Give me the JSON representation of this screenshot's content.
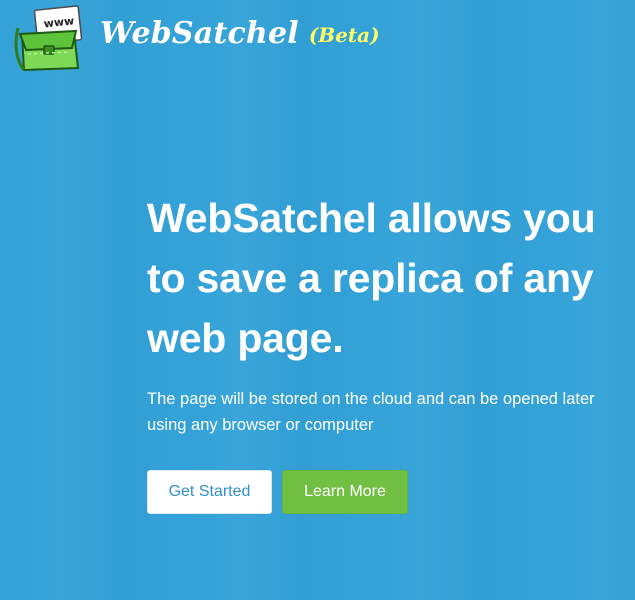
{
  "header": {
    "logo_icon": "satchel-www-icon",
    "brand_name": "WebSatchel",
    "brand_badge": "(Beta)",
    "logo_text": "www"
  },
  "hero": {
    "headline": "WebSatchel allows you to save a replica of any web page.",
    "subtext": "The page will be stored on the cloud and can be opened later using any browser or computer",
    "primary_button": "Get Started",
    "secondary_button": "Learn More"
  },
  "colors": {
    "background": "#33a2d8",
    "beta": "#ffff66",
    "primary_button_text": "#2f8fc9",
    "secondary_button_bg": "#72c043"
  }
}
